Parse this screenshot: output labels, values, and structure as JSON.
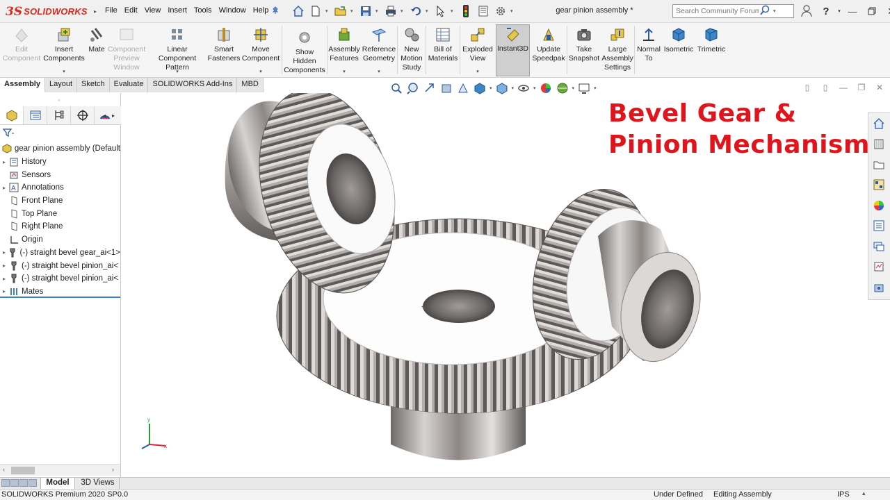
{
  "app": {
    "logo_prefix": "3S",
    "logo_name": "SOLIDWORKS",
    "document_title": "gear pinion assembly *",
    "menus": [
      "File",
      "Edit",
      "View",
      "Insert",
      "Tools",
      "Window",
      "Help"
    ]
  },
  "search": {
    "placeholder": "Search Community Forum"
  },
  "command_manager": {
    "buttons": [
      {
        "label": "Edit\nComponent",
        "icon": "edit-component-icon",
        "enabled": false
      },
      {
        "label": "Insert\nComponents",
        "icon": "insert-components-icon",
        "enabled": true
      },
      {
        "label": "Mate",
        "icon": "mate-icon",
        "enabled": true
      },
      {
        "label": "Component\nPreview\nWindow",
        "icon": "preview-window-icon",
        "enabled": false
      },
      {
        "label": "Linear Component\nPattern",
        "icon": "linear-pattern-icon",
        "enabled": true
      },
      {
        "label": "Smart\nFasteners",
        "icon": "smart-fasteners-icon",
        "enabled": true
      },
      {
        "label": "Move\nComponent",
        "icon": "move-component-icon",
        "enabled": true
      },
      {
        "label": "Show\nHidden\nComponents",
        "icon": "show-hidden-icon",
        "enabled": true
      },
      {
        "label": "Assembly\nFeatures",
        "icon": "assembly-features-icon",
        "enabled": true
      },
      {
        "label": "Reference\nGeometry",
        "icon": "reference-geometry-icon",
        "enabled": true
      },
      {
        "label": "New\nMotion\nStudy",
        "icon": "motion-study-icon",
        "enabled": true
      },
      {
        "label": "Bill of\nMaterials",
        "icon": "bom-icon",
        "enabled": true
      },
      {
        "label": "Exploded\nView",
        "icon": "exploded-view-icon",
        "enabled": true
      },
      {
        "label": "Instant3D",
        "icon": "instant3d-icon",
        "enabled": true
      },
      {
        "label": "Update\nSpeedpak",
        "icon": "speedpak-icon",
        "enabled": true
      },
      {
        "label": "Take\nSnapshot",
        "icon": "camera-icon",
        "enabled": true
      },
      {
        "label": "Large\nAssembly\nSettings",
        "icon": "large-assembly-icon",
        "enabled": true
      },
      {
        "label": "Normal\nTo",
        "icon": "normal-to-icon",
        "enabled": true
      },
      {
        "label": "Isometric",
        "icon": "isometric-icon",
        "enabled": true
      },
      {
        "label": "Trimetric",
        "icon": "trimetric-icon",
        "enabled": true
      }
    ]
  },
  "tabs": [
    {
      "label": "Assembly",
      "active": true
    },
    {
      "label": "Layout"
    },
    {
      "label": "Sketch"
    },
    {
      "label": "Evaluate"
    },
    {
      "label": "SOLIDWORKS Add-Ins"
    },
    {
      "label": "MBD"
    }
  ],
  "feature_tree": {
    "root": "gear pinion assembly  (Default",
    "items": [
      {
        "label": "History",
        "expandable": true,
        "icon": "history-icon"
      },
      {
        "label": "Sensors",
        "expandable": false,
        "icon": "sensors-icon"
      },
      {
        "label": "Annotations",
        "expandable": true,
        "icon": "annotations-icon"
      },
      {
        "label": "Front Plane",
        "expandable": false,
        "icon": "plane-icon"
      },
      {
        "label": "Top Plane",
        "expandable": false,
        "icon": "plane-icon"
      },
      {
        "label": "Right Plane",
        "expandable": false,
        "icon": "plane-icon"
      },
      {
        "label": "Origin",
        "expandable": false,
        "icon": "origin-icon"
      },
      {
        "label": "(-) straight bevel gear_ai<1>",
        "expandable": true,
        "icon": "part-icon"
      },
      {
        "label": "(-) straight bevel pinion_ai<",
        "expandable": true,
        "icon": "part-icon"
      },
      {
        "label": "(-) straight bevel pinion_ai<",
        "expandable": true,
        "icon": "part-icon"
      },
      {
        "label": "Mates",
        "expandable": true,
        "icon": "mates-icon"
      }
    ]
  },
  "graphics": {
    "headline_line1": "Bevel Gear &",
    "headline_line2": "Pinion Mechanism",
    "triad_x": "x",
    "triad_y": "y",
    "headline_color": "#e0151b"
  },
  "bottom_tabs": [
    {
      "label": "Model",
      "active": true
    },
    {
      "label": "3D Views"
    }
  ],
  "status_bar": {
    "product": "SOLIDWORKS Premium 2020 SP0.0",
    "definition": "Under Defined",
    "mode": "Editing Assembly",
    "units": "IPS"
  }
}
